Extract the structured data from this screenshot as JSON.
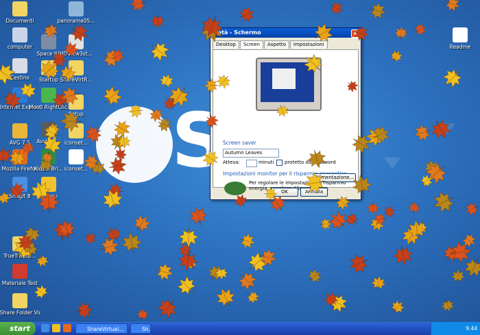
{
  "desktop_icons": [
    {
      "label": "Documenti",
      "color": "#f2d463"
    },
    {
      "label": "computer",
      "color": "#c8d5e8"
    },
    {
      "label": "Cestino",
      "color": "#d9dde6"
    },
    {
      "label": "Internet Explorer",
      "color": "#2d7bd6"
    },
    {
      "label": "AVG 7.5",
      "color": "#e9b638"
    },
    {
      "label": "Mozilla Firefox",
      "color": "#e26b1d"
    },
    {
      "label": "SnagIt 8",
      "color": "#4a8fe0"
    },
    {
      "label": "TrueTransp...",
      "color": "#f2d463"
    },
    {
      "label": "Materiale Test",
      "color": "#d23b2f"
    },
    {
      "label": "Share Folder Virt Box - PC",
      "color": "#f2d463"
    },
    {
      "label": "Space IIA",
      "color": "#7f8da3"
    },
    {
      "label": "Startup",
      "color": "#f2d463"
    },
    {
      "label": "Moo0 RightClic...",
      "color": "#4bb64b"
    },
    {
      "label": "Avvia H...",
      "color": "#5b5b5b"
    },
    {
      "label": "Kidzui Bri...",
      "color": "#2a8e48"
    },
    {
      "label": "Mikogo",
      "color": "#f2c230"
    },
    {
      "label": "panorama05...",
      "color": "#8fb6d9"
    },
    {
      "label": "HDView3st...",
      "color": "#e3e3e3"
    },
    {
      "label": "ShareVirtR...",
      "color": "#f2d463"
    },
    {
      "label": "Setup",
      "color": "#f2d463"
    },
    {
      "label": "iconset...",
      "color": "#f2d463"
    },
    {
      "label": "iconset...",
      "color": "#ffffff"
    },
    {
      "label": "Readme",
      "color": "#ffffff"
    }
  ],
  "dialog": {
    "title": "rietà - Schermo",
    "close": "×",
    "tabs": [
      "Desktop",
      "Screen",
      "Aspetto",
      "Impostazioni"
    ],
    "screensaver_title": "Screen saver",
    "screensaver_value": "Autumn Leaves",
    "wait_label": "Attesa:",
    "wait_unit": "minuti",
    "password_label": "protetto da password",
    "energy_title": "Impostazioni monitor per il risparmio energetico",
    "energy_text": "Per regolare le impostazioni di risparmio energia, scegliere Alimentazione.",
    "energy_button": "Alimentazione...",
    "ok": "OK",
    "cancel": "Annulla"
  },
  "taskbar": {
    "start": "start",
    "tasks": [
      "ShareVirtual...",
      "Sh..."
    ],
    "clock": "9.44"
  },
  "colors": {
    "leaf_palette": [
      "#e8a317",
      "#d9531e",
      "#f0c020",
      "#c4401c",
      "#e07a1f",
      "#b8861b"
    ]
  }
}
